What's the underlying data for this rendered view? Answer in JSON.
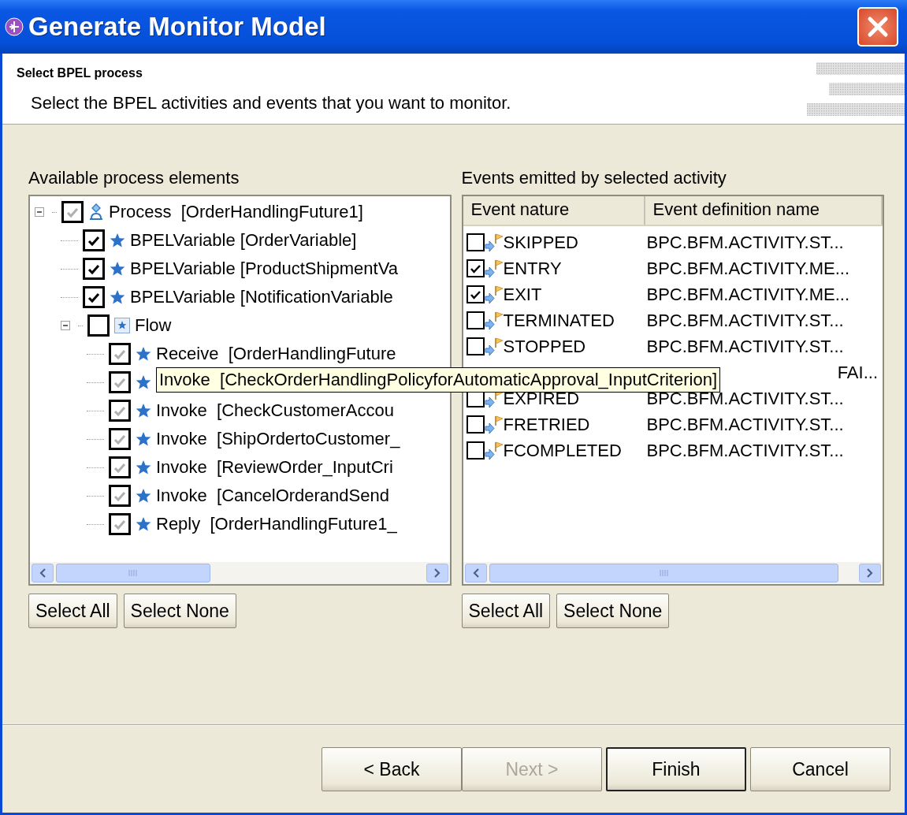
{
  "window": {
    "title": "Generate Monitor Model"
  },
  "header": {
    "title": "Select BPEL process",
    "description": "Select the BPEL activities and events that you want to monitor."
  },
  "process_panel": {
    "label": "Available process elements",
    "tree": [
      {
        "kind": "process",
        "label": "Process  [OrderHandlingFuture1]",
        "checked": true,
        "grayed": true,
        "expanded": true,
        "children": [
          {
            "kind": "variable",
            "label": "BPELVariable [OrderVariable]",
            "checked": true,
            "grayed": false
          },
          {
            "kind": "variable",
            "label": "BPELVariable [ProductShipmentVa",
            "checked": true,
            "grayed": false
          },
          {
            "kind": "variable",
            "label": "BPELVariable [NotificationVariable",
            "checked": true,
            "grayed": false
          },
          {
            "kind": "flow",
            "label": "Flow",
            "checked": false,
            "expanded": true,
            "children": [
              {
                "kind": "activity",
                "label": "Receive  [OrderHandlingFuture",
                "checked": true,
                "grayed": true
              },
              {
                "kind": "activity",
                "label": "Invoke  [CheckOrderHandlingPolicyforAutomaticApproval_InputCriterion]",
                "checked": true,
                "grayed": true,
                "tooltip": true
              },
              {
                "kind": "activity",
                "label": "Invoke  [CheckCustomerAccou",
                "checked": true,
                "grayed": true
              },
              {
                "kind": "activity",
                "label": "Invoke  [ShipOrdertoCustomer_",
                "checked": true,
                "grayed": true
              },
              {
                "kind": "activity",
                "label": "Invoke  [ReviewOrder_InputCri",
                "checked": true,
                "grayed": true
              },
              {
                "kind": "activity",
                "label": "Invoke  [CancelOrderandSend",
                "checked": true,
                "grayed": true
              },
              {
                "kind": "activity",
                "label": "Reply  [OrderHandlingFuture1_",
                "checked": true,
                "grayed": true
              }
            ]
          }
        ]
      }
    ],
    "buttons": [
      "Select All",
      "Select None"
    ]
  },
  "events_panel": {
    "label": "Events emitted by selected activity",
    "columns": [
      "Event nature",
      "Event definition name"
    ],
    "rows": [
      {
        "name": "SKIPPED",
        "definition": "BPC.BFM.ACTIVITY.ST...",
        "checked": false
      },
      {
        "name": "ENTRY",
        "definition": "BPC.BFM.ACTIVITY.ME...",
        "checked": true
      },
      {
        "name": "EXIT",
        "definition": "BPC.BFM.ACTIVITY.ME...",
        "checked": true
      },
      {
        "name": "TERMINATED",
        "definition": "BPC.BFM.ACTIVITY.ST...",
        "checked": false
      },
      {
        "name": "STOPPED",
        "definition": "BPC.BFM.ACTIVITY.ST...",
        "checked": false
      },
      {
        "definition": "FAI..."
      },
      {
        "name": "EXPIRED",
        "definition": "BPC.BFM.ACTIVITY.ST...",
        "checked": false
      },
      {
        "name": "FRETRIED",
        "definition": "BPC.BFM.ACTIVITY.ST...",
        "checked": false
      },
      {
        "name": "FCOMPLETED",
        "definition": "BPC.BFM.ACTIVITY.ST...",
        "checked": false
      }
    ],
    "buttons": [
      "Select All",
      "Select None"
    ]
  },
  "buttons": [
    {
      "label": "< Back",
      "disabled": false,
      "default": false
    },
    {
      "label": "Next >",
      "disabled": true,
      "default": false
    },
    {
      "label": "Finish",
      "disabled": false,
      "default": true
    },
    {
      "label": "Cancel",
      "disabled": false,
      "default": false
    }
  ]
}
